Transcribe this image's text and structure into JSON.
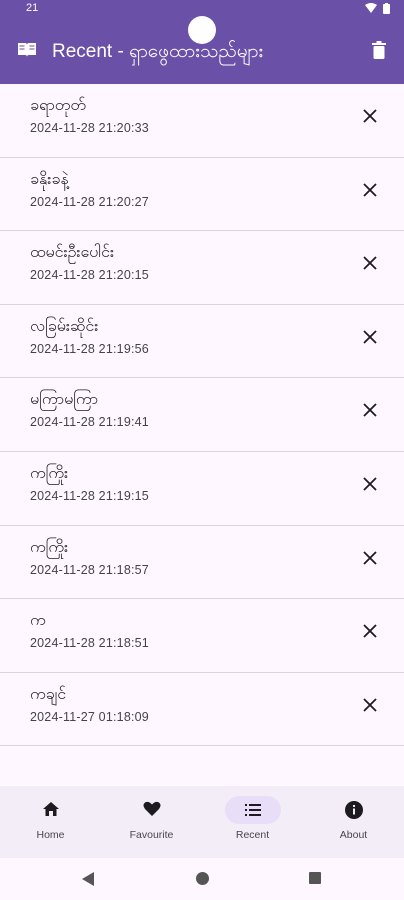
{
  "status_bar": {
    "time": "21"
  },
  "app_bar": {
    "title": "Recent - ရှာဖွေထားသည်များ",
    "left_icon": "book-icon",
    "right_icon": "trash-icon"
  },
  "recent": [
    {
      "word": "ခရာတုတ်",
      "time": "2024-11-28 21:20:33"
    },
    {
      "word": "ခနိုးခနဲ့",
      "time": "2024-11-28 21:20:27"
    },
    {
      "word": "ထမင်းဦးပေါင်း",
      "time": "2024-11-28 21:20:15"
    },
    {
      "word": "လခြမ်းဆိုင်း",
      "time": "2024-11-28 21:19:56"
    },
    {
      "word": "မကြာမကြာ",
      "time": "2024-11-28 21:19:41"
    },
    {
      "word": "ကကြိုး",
      "time": "2024-11-28 21:19:15"
    },
    {
      "word": "ကကြိုး",
      "time": "2024-11-28 21:18:57"
    },
    {
      "word": "က",
      "time": "2024-11-28 21:18:51"
    },
    {
      "word": "ကချင်",
      "time": "2024-11-27 01:18:09"
    }
  ],
  "bottom_nav": {
    "items": [
      {
        "label": "Home",
        "icon": "home-icon"
      },
      {
        "label": "Favourite",
        "icon": "heart-icon"
      },
      {
        "label": "Recent",
        "icon": "list-icon",
        "active": true
      },
      {
        "label": "About",
        "icon": "info-icon"
      }
    ]
  },
  "colors": {
    "primary": "#6a50a7",
    "background": "#fef7ff",
    "nav_background": "#f3edf7",
    "active_indicator": "#e8def8"
  }
}
